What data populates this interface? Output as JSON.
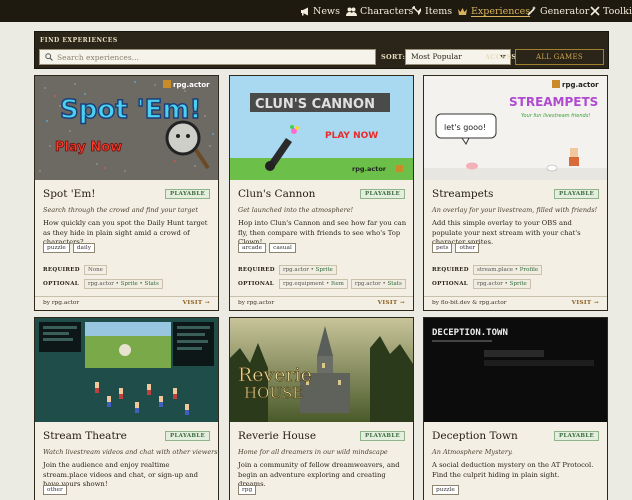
{
  "nav": {
    "items": [
      {
        "label": "News",
        "icon": "megaphone-icon",
        "active": false
      },
      {
        "label": "Characters",
        "icon": "users-icon",
        "active": false
      },
      {
        "label": "Items",
        "icon": "sword-shield-icon",
        "active": false
      },
      {
        "label": "Experiences",
        "icon": "crown-icon",
        "active": true
      },
      {
        "label": "Generator",
        "icon": "wand-icon",
        "active": false
      },
      {
        "label": "Toolkit",
        "icon": "tools-icon",
        "active": false
      }
    ]
  },
  "filter": {
    "title": "FIND EXPERIENCES",
    "search_placeholder": "Search experiences...",
    "sort_label": "SORT:",
    "sort_value": "Most Popular",
    "access_label": "ACCESS:",
    "access_button": "ALL GAMES"
  },
  "labels": {
    "required": "REQUIRED",
    "optional": "OPTIONAL",
    "visit": "VISIT →"
  },
  "cards": [
    {
      "title": "Spot 'Em!",
      "badge": "PLAYABLE",
      "tagline": "Search through the crowd and find your target",
      "description": "How quickly can you spot the Daily Hunt target as they hide in plain sight amid a crowd of characters?",
      "tags": [
        "puzzle",
        "daily"
      ],
      "required": [
        {
          "pre": "None",
          "strong": ""
        }
      ],
      "optional": [
        {
          "pre": "rpg.actor • ",
          "strong": "Sprite • Stats"
        }
      ],
      "by": "by rpg.actor",
      "image": {
        "headline": "Spot 'Em!",
        "subline": "Play Now",
        "brand": "rpg.actor"
      }
    },
    {
      "title": "Clun's Cannon",
      "badge": "PLAYABLE",
      "tagline": "Get launched into the atmosphere!",
      "description": "Hop into Clun's Cannon and see how far you can fly, then compare with friends to see who's Top Clown!",
      "tags": [
        "arcade",
        "casual"
      ],
      "required": [
        {
          "pre": "rpg.actor • ",
          "strong": "Sprite"
        }
      ],
      "optional": [
        {
          "pre": "rpg.equipment • ",
          "strong": "Item"
        },
        {
          "pre": "rpg.actor • ",
          "strong": "Stats"
        }
      ],
      "by": "by rpg.actor",
      "image": {
        "headline": "CLUN'S CANNON",
        "subline": "PLAY NOW",
        "brand": "rpg.actor"
      }
    },
    {
      "title": "Streampets",
      "badge": "PLAYABLE",
      "tagline": "An overlay for your livestream, filled with friends!",
      "description": "Add this simple overlay to your OBS and populate your next stream with your chat's character sprites.",
      "tags": [
        "pets",
        "other"
      ],
      "required": [
        {
          "pre": "stream.place • ",
          "strong": "Profile"
        }
      ],
      "optional": [
        {
          "pre": "rpg.actor • ",
          "strong": "Sprite"
        }
      ],
      "by": "by flo-bit.dev & rpg.actor",
      "image": {
        "headline": "STREAMPETS",
        "subline": "Your fun livestream friends!",
        "brand": "rpg.actor",
        "bubble": "let's gooo!"
      }
    },
    {
      "title": "Stream Theatre",
      "badge": "PLAYABLE",
      "tagline": "Watch livestream videos and chat with other viewers",
      "description": "Join the audience and enjoy realtime stream.place videos and chat, or sign-up and have yours shown!",
      "tags": [
        "other"
      ],
      "by": "",
      "image": {}
    },
    {
      "title": "Reverie House",
      "badge": "PLAYABLE",
      "tagline": "Home for all dreamers in our wild mindscape",
      "description": "Join a community of fellow dreamweavers, and begin an adventure exploring and creating dreams.",
      "tags": [
        "rpg"
      ],
      "by": "",
      "image": {
        "headline": "Reverie",
        "subline": "HOUSE"
      }
    },
    {
      "title": "Deception Town",
      "badge": "PLAYABLE",
      "tagline": "An Atmosphere Mystery.",
      "description": "A social deduction mystery on the AT Protocol. Find the culprit hiding in plain sight.",
      "tags": [
        "puzzle"
      ],
      "by": "",
      "image": {
        "headline": "DECEPTION.TOWN"
      }
    }
  ]
}
